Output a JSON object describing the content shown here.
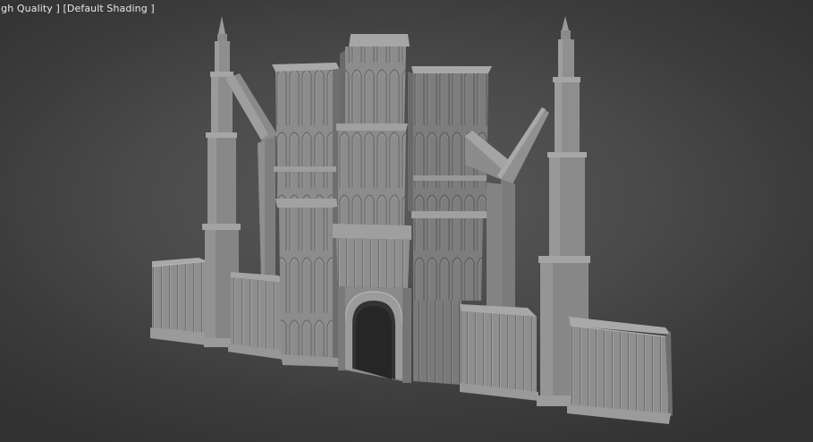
{
  "viewport": {
    "quality_label": "igh Quality ]",
    "shading_label": "[Default Shading ]"
  }
}
